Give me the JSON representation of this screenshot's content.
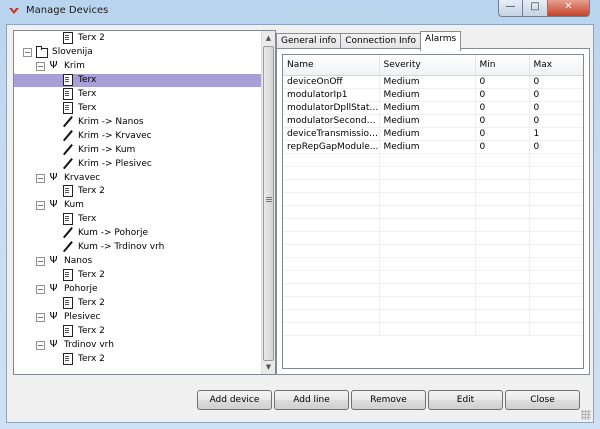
{
  "window": {
    "title": "Manage Devices",
    "min_glyph": "—",
    "max_glyph": "□",
    "close_glyph": "✕"
  },
  "tree": [
    {
      "label": "Terx 2",
      "icon": "doc-icon",
      "level": 2,
      "expander": ""
    },
    {
      "label": "Slovenija",
      "icon": "folder-icon",
      "level": 0,
      "expander": "−"
    },
    {
      "label": "Krim",
      "icon": "antenna-icon",
      "level": 1,
      "expander": "−"
    },
    {
      "label": "Terx",
      "icon": "doc-icon",
      "level": 2,
      "expander": "",
      "selected": true
    },
    {
      "label": "Terx",
      "icon": "doc-icon",
      "level": 2,
      "expander": ""
    },
    {
      "label": "Terx",
      "icon": "doc-icon",
      "level": 2,
      "expander": ""
    },
    {
      "label": "Krim -> Nanos",
      "icon": "line-icon",
      "level": 2,
      "expander": ""
    },
    {
      "label": "Krim -> Krvavec",
      "icon": "line-icon",
      "level": 2,
      "expander": ""
    },
    {
      "label": "Krim -> Kum",
      "icon": "line-icon",
      "level": 2,
      "expander": ""
    },
    {
      "label": "Krim -> Plesivec",
      "icon": "line-icon",
      "level": 2,
      "expander": ""
    },
    {
      "label": "Krvavec",
      "icon": "antenna-icon",
      "level": 1,
      "expander": "−"
    },
    {
      "label": "Terx 2",
      "icon": "doc-icon",
      "level": 2,
      "expander": ""
    },
    {
      "label": "Kum",
      "icon": "antenna-icon",
      "level": 1,
      "expander": "−"
    },
    {
      "label": "Terx",
      "icon": "doc-icon",
      "level": 2,
      "expander": ""
    },
    {
      "label": "Kum -> Pohorje",
      "icon": "line-icon",
      "level": 2,
      "expander": ""
    },
    {
      "label": "Kum -> Trdinov vrh",
      "icon": "line-icon",
      "level": 2,
      "expander": ""
    },
    {
      "label": "Nanos",
      "icon": "antenna-icon",
      "level": 1,
      "expander": "−"
    },
    {
      "label": "Terx 2",
      "icon": "doc-icon",
      "level": 2,
      "expander": ""
    },
    {
      "label": "Pohorje",
      "icon": "antenna-icon",
      "level": 1,
      "expander": "−"
    },
    {
      "label": "Terx 2",
      "icon": "doc-icon",
      "level": 2,
      "expander": ""
    },
    {
      "label": "Plesivec",
      "icon": "antenna-icon",
      "level": 1,
      "expander": "−"
    },
    {
      "label": "Terx 2",
      "icon": "doc-icon",
      "level": 2,
      "expander": ""
    },
    {
      "label": "Trdinov vrh",
      "icon": "antenna-icon",
      "level": 1,
      "expander": "−"
    },
    {
      "label": "Terx 2",
      "icon": "doc-icon",
      "level": 2,
      "expander": ""
    }
  ],
  "tabs": [
    {
      "label": "General info",
      "active": false
    },
    {
      "label": "Connection Info",
      "active": false
    },
    {
      "label": "Alarms",
      "active": true
    }
  ],
  "alarms": {
    "columns": [
      "Name",
      "Severity",
      "Min",
      "Max"
    ],
    "rows": [
      [
        "deviceOnOff",
        "Medium",
        "0",
        "0"
      ],
      [
        "modulatorIp1",
        "Medium",
        "0",
        "0"
      ],
      [
        "modulatorDpllStatus",
        "Medium",
        "0",
        "0"
      ],
      [
        "modulatorSecondar...",
        "Medium",
        "0",
        "0"
      ],
      [
        "deviceTransmission...",
        "Medium",
        "0",
        "1"
      ],
      [
        "repRepGapModule...",
        "Medium",
        "0",
        "0"
      ]
    ]
  },
  "buttons": {
    "add_device": "Add device",
    "add_line": "Add line",
    "remove": "Remove",
    "edit": "Edit",
    "close": "Close"
  },
  "colors": {
    "selection": "#a79fd5",
    "app_icon": "#c0392b"
  }
}
